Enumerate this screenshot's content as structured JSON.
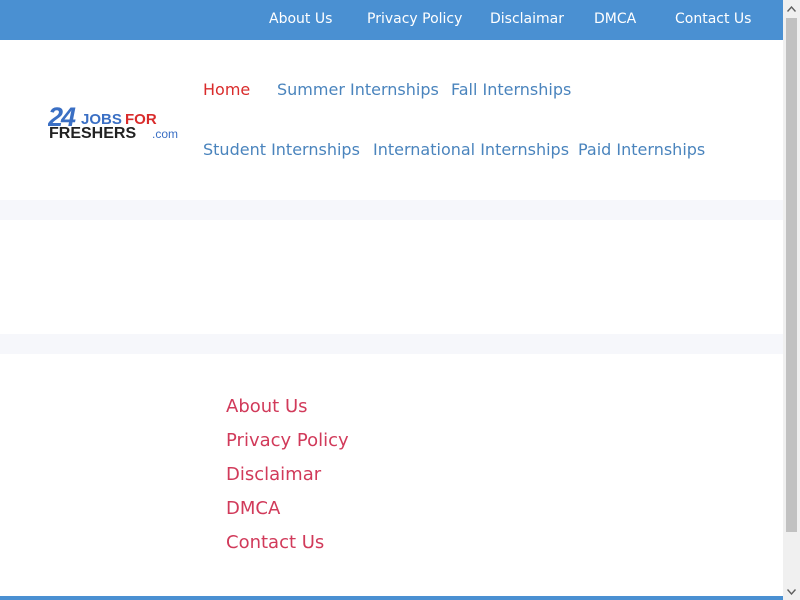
{
  "topbar": {
    "links": [
      "About Us",
      "Privacy Policy",
      "Disclaimar",
      "DMCA",
      "Contact Us"
    ],
    "background": "#4a90d2"
  },
  "logo": {
    "number": "24",
    "line1": "JOBS",
    "line1_accent": "FOR",
    "line2": "FRESHERS",
    "suffix": ".com"
  },
  "nav": {
    "row1": [
      "Home",
      "Summer Internships",
      "Fall Internships"
    ],
    "row2": [
      "Student Internships",
      "International Internships",
      "Paid Internships"
    ],
    "active": "Home",
    "link_color": "#4a84bd",
    "active_color": "#d92b2b"
  },
  "footer": {
    "links": [
      "About Us",
      "Privacy Policy",
      "Disclaimar",
      "DMCA",
      "Contact Us"
    ],
    "link_color": "#d13a5a"
  },
  "icons": {
    "scroll_up": "chevron-up-icon",
    "scroll_down": "chevron-down-icon"
  }
}
